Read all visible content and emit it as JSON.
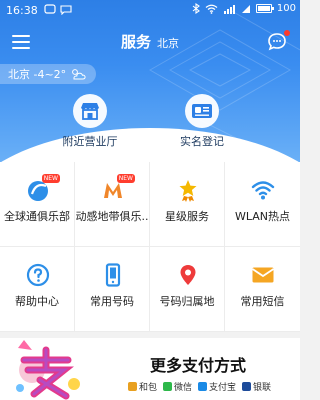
{
  "status": {
    "time": "16:38",
    "battery": "100",
    "battery_level": 1.0
  },
  "header": {
    "title": "服务",
    "city": "北京"
  },
  "weather": {
    "text": "北京 -4~2°"
  },
  "quick": [
    {
      "label": "附近营业厅"
    },
    {
      "label": "实名登记"
    }
  ],
  "grid": [
    {
      "label": "全球通俱乐部",
      "badge": "NEW"
    },
    {
      "label": "动感地带俱乐..",
      "badge": "NEW"
    },
    {
      "label": "星级服务"
    },
    {
      "label": "WLAN热点"
    },
    {
      "label": "帮助中心"
    },
    {
      "label": "常用号码"
    },
    {
      "label": "号码归属地"
    },
    {
      "label": "常用短信"
    }
  ],
  "pay": {
    "title": "更多支付方式",
    "methods": [
      {
        "label": "和包",
        "color": "#e8a020"
      },
      {
        "label": "微信",
        "color": "#2db84a"
      },
      {
        "label": "支付宝",
        "color": "#1a8ae6"
      },
      {
        "label": "银联",
        "color": "#1d4b9a"
      }
    ]
  },
  "colors": {
    "brand": "#2d7fe6"
  }
}
